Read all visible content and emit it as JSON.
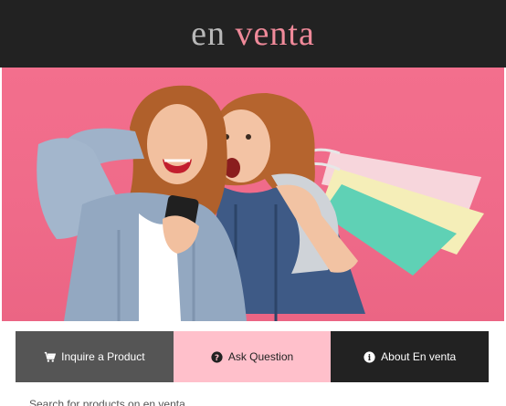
{
  "header": {
    "logo_part1": "en",
    "logo_part2": "venta"
  },
  "hero": {
    "alt": "Two excited women looking at a phone holding shopping bags"
  },
  "nav": {
    "items": [
      {
        "label": "Inquire a Product",
        "icon": "cart-icon"
      },
      {
        "label": "Ask Question",
        "icon": "question-circle-icon"
      },
      {
        "label": "About En venta",
        "icon": "info-circle-icon"
      }
    ]
  },
  "footer": {
    "partial_text": "Search for products on en venta"
  },
  "colors": {
    "header_bg": "#222222",
    "logo_grey": "#b8b8b8",
    "logo_pink": "#f08a9a",
    "hero_pink": "#f06e8c",
    "nav_grey": "#555555",
    "nav_pink": "#ffc0cb",
    "nav_dark": "#222222"
  }
}
